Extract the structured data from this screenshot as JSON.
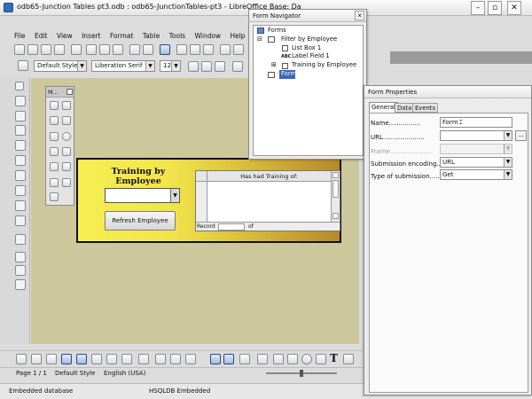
{
  "main_window": {
    "title": "odb65-Junction Tables pt3.odb : odb65-JunctionTables-pt3 - LibreOffice Base: Da",
    "menu": [
      "File",
      "Edit",
      "View",
      "Insert",
      "Format",
      "Table",
      "Tools",
      "Window",
      "Help"
    ],
    "paragraph_style": "Default Style",
    "font_name": "Liberation Serif",
    "font_size": "12"
  },
  "mini_toolbar": {
    "title": "M..."
  },
  "form": {
    "title_line1": "Training by",
    "title_line2": "Employee",
    "refresh_button": "Refresh Employee",
    "grid_header": "Has had Training of:",
    "grid_record_label": "Record",
    "grid_of_label": "of"
  },
  "status_bar": {
    "page": "Page 1 / 1",
    "style": "Default Style",
    "language": "English (USA)"
  },
  "bottom_bar": {
    "left": "Embedded database",
    "middle": "HSQLDB Embedded"
  },
  "navigator": {
    "title": "Form Navigator",
    "tree": {
      "root": "Forms",
      "filter": "Filter by Employee",
      "listbox": "List Box 1",
      "label_field": "Label Field 1",
      "training": "Training by Employee",
      "form": "Form",
      "label_prefix": "ABC"
    }
  },
  "properties": {
    "title": "Form Properties",
    "tabs": [
      "General",
      "Data",
      "Events"
    ],
    "name_label": "Name",
    "name_value": "Form",
    "url_label": "URL",
    "frame_label": "Frame",
    "encoding_label": "Submission encoding",
    "encoding_value": "URL",
    "submission_label": "Type of submission",
    "submission_value": "Get",
    "browse_label": "..."
  },
  "colors": {
    "form_yellow": "#f6ee52",
    "form_gold": "#b7892a",
    "document_bg": "#cdc79c",
    "selection": "#3e67b5"
  }
}
